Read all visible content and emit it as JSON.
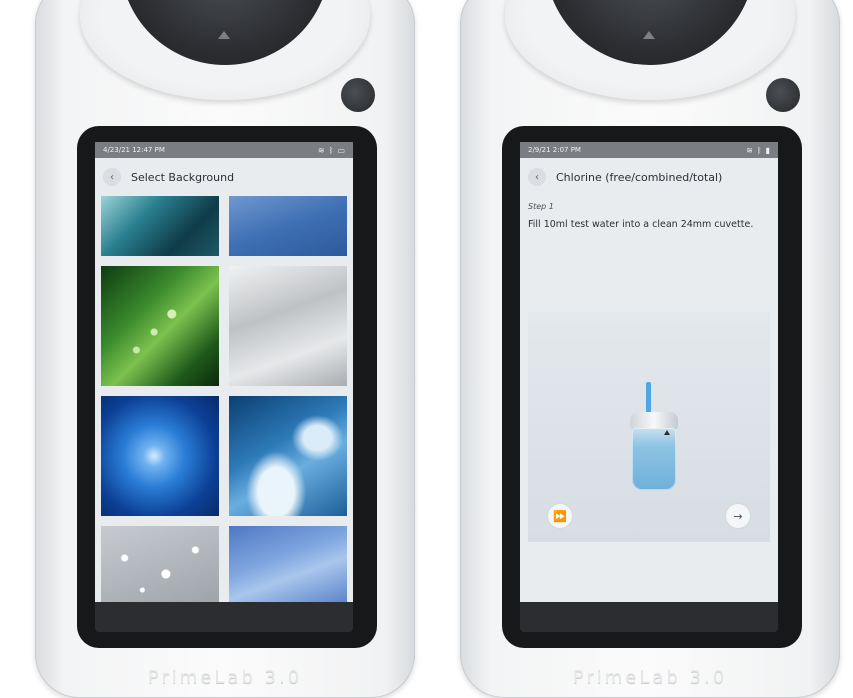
{
  "left_device": {
    "status_time": "4/23/21 12:47 PM",
    "status_icons": [
      "wifi-icon",
      "bluetooth-icon",
      "battery-icon"
    ],
    "screen_title": "Select Background",
    "backgrounds": [
      "teal-leaf-drops",
      "blue-gradient",
      "green-leaf-drops",
      "silver-gradient",
      "blue-burst",
      "blue-sky-clouds",
      "water-drops-gray",
      "blue-sky-light"
    ],
    "brand": "PrimeLab 3.0"
  },
  "right_device": {
    "status_time": "2/9/21 2:07 PM",
    "status_icons": [
      "wifi-icon",
      "bluetooth-icon",
      "battery-icon"
    ],
    "screen_title": "Chlorine (free/combined/total)",
    "step_label": "Step 1",
    "step_text": "Fill 10ml test water into a clean 24mm cuvette.",
    "skip_icon": "fast-forward-icon",
    "next_icon": "arrow-right-circle-icon",
    "brand": "PrimeLab 3.0"
  }
}
